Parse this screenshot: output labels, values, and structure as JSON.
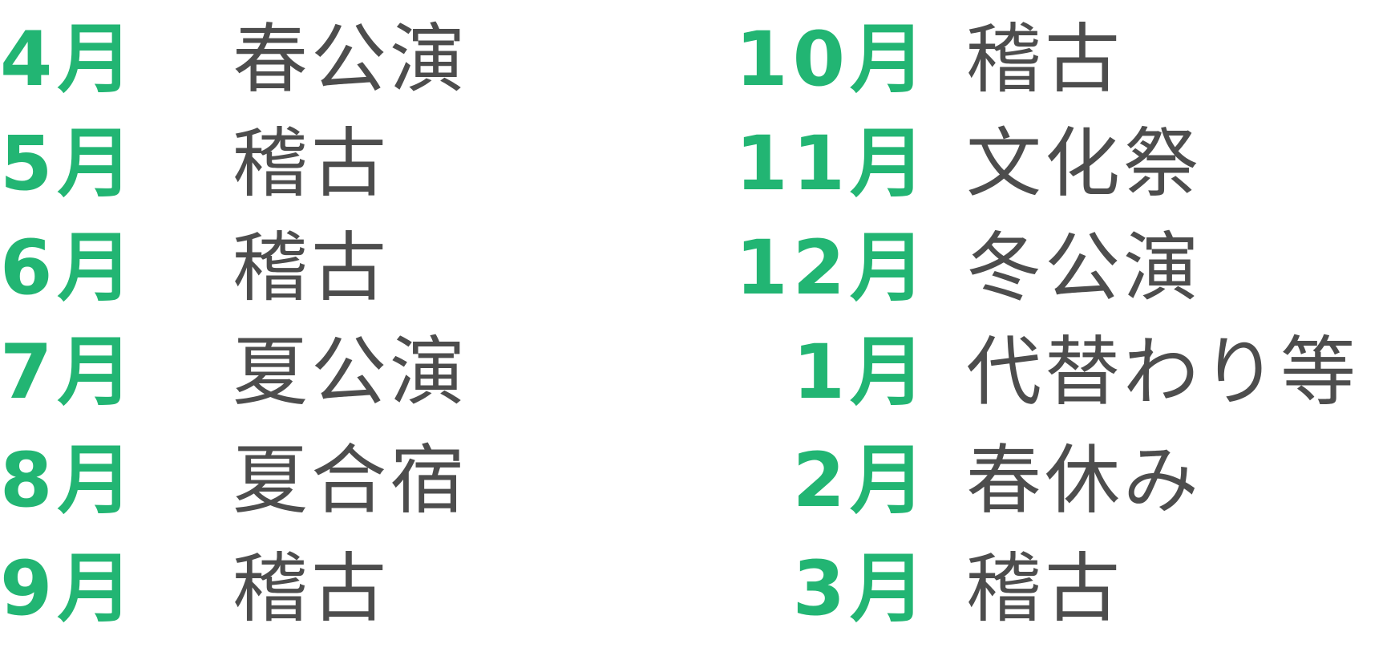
{
  "left_column": [
    {
      "month": "4月",
      "event": "春公演"
    },
    {
      "month": "5月",
      "event": "稽古"
    },
    {
      "month": "6月",
      "event": "稽古"
    },
    {
      "month": "7月",
      "event": "夏公演"
    },
    {
      "month": "8月",
      "event": "夏合宿"
    },
    {
      "month": "9月",
      "event": "稽古"
    }
  ],
  "right_column": [
    {
      "month": "10月",
      "event": "稽古"
    },
    {
      "month": "11月",
      "event": "文化祭"
    },
    {
      "month": "12月",
      "event": "冬公演"
    },
    {
      "month": "1月",
      "event": "代替わり等"
    },
    {
      "month": "2月",
      "event": "春休み"
    },
    {
      "month": "3月",
      "event": "稽古"
    }
  ],
  "colors": {
    "month": "#22b573",
    "event": "#4d4d4d"
  }
}
